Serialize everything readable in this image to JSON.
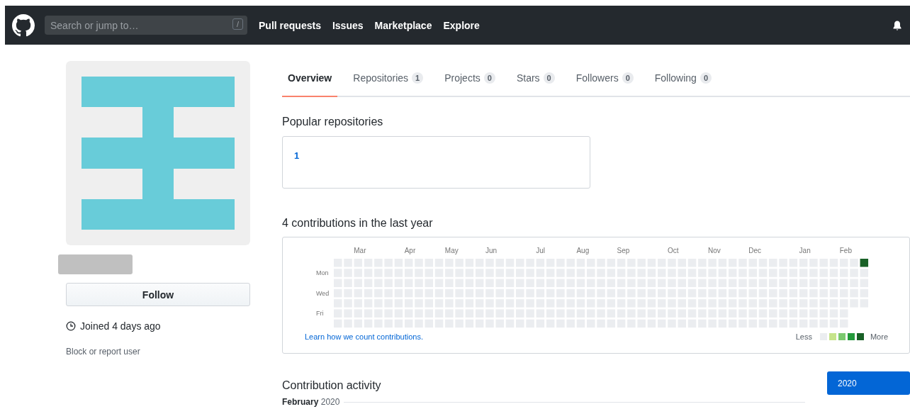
{
  "header": {
    "search": {
      "placeholder": "Search or jump to…",
      "shortcut": "/"
    },
    "nav": [
      "Pull requests",
      "Issues",
      "Marketplace",
      "Explore"
    ]
  },
  "profile": {
    "follow_button": "Follow",
    "joined": "Joined 4 days ago",
    "block_link": "Block or report user"
  },
  "tabs": [
    {
      "label": "Overview",
      "selected": true
    },
    {
      "label": "Repositories",
      "count": "1",
      "selected": false
    },
    {
      "label": "Projects",
      "count": "0",
      "selected": false
    },
    {
      "label": "Stars",
      "count": "0",
      "selected": false
    },
    {
      "label": "Followers",
      "count": "0",
      "selected": false
    },
    {
      "label": "Following",
      "count": "0",
      "selected": false
    }
  ],
  "popular": {
    "title": "Popular repositories",
    "repos": [
      {
        "name": "1"
      }
    ]
  },
  "contributions": {
    "title": "4 contributions in the last year",
    "months": [
      "Mar",
      "Apr",
      "May",
      "Jun",
      "Jul",
      "Aug",
      "Sep",
      "Oct",
      "Nov",
      "Dec",
      "Jan",
      "Feb"
    ],
    "days": [
      "Mon",
      "Wed",
      "Fri"
    ],
    "weeks": [
      [
        {
          "color": "#ebedf0"
        },
        {
          "color": "#ebedf0"
        },
        {
          "color": "#ebedf0"
        },
        {
          "color": "#ebedf0"
        },
        {
          "color": "#ebedf0"
        },
        {
          "color": "#ebedf0"
        },
        {
          "color": "#ebedf0"
        }
      ],
      [
        {
          "color": "#ebedf0"
        },
        {
          "color": "#ebedf0"
        },
        {
          "color": "#ebedf0"
        },
        {
          "color": "#ebedf0"
        },
        {
          "color": "#ebedf0"
        },
        {
          "color": "#ebedf0"
        },
        {
          "color": "#ebedf0"
        }
      ],
      [
        {
          "color": "#ebedf0"
        },
        {
          "color": "#ebedf0"
        },
        {
          "color": "#ebedf0"
        },
        {
          "color": "#ebedf0"
        },
        {
          "color": "#ebedf0"
        },
        {
          "color": "#ebedf0"
        },
        {
          "color": "#ebedf0"
        }
      ],
      [
        {
          "color": "#ebedf0"
        },
        {
          "color": "#ebedf0"
        },
        {
          "color": "#ebedf0"
        },
        {
          "color": "#ebedf0"
        },
        {
          "color": "#ebedf0"
        },
        {
          "color": "#ebedf0"
        },
        {
          "color": "#ebedf0"
        }
      ],
      [
        {
          "color": "#ebedf0"
        },
        {
          "color": "#ebedf0"
        },
        {
          "color": "#ebedf0"
        },
        {
          "color": "#ebedf0"
        },
        {
          "color": "#ebedf0"
        },
        {
          "color": "#ebedf0"
        },
        {
          "color": "#ebedf0"
        }
      ],
      [
        {
          "color": "#ebedf0"
        },
        {
          "color": "#ebedf0"
        },
        {
          "color": "#ebedf0"
        },
        {
          "color": "#ebedf0"
        },
        {
          "color": "#ebedf0"
        },
        {
          "color": "#ebedf0"
        },
        {
          "color": "#ebedf0"
        }
      ],
      [
        {
          "color": "#ebedf0"
        },
        {
          "color": "#ebedf0"
        },
        {
          "color": "#ebedf0"
        },
        {
          "color": "#ebedf0"
        },
        {
          "color": "#ebedf0"
        },
        {
          "color": "#ebedf0"
        },
        {
          "color": "#ebedf0"
        }
      ],
      [
        {
          "color": "#ebedf0"
        },
        {
          "color": "#ebedf0"
        },
        {
          "color": "#ebedf0"
        },
        {
          "color": "#ebedf0"
        },
        {
          "color": "#ebedf0"
        },
        {
          "color": "#ebedf0"
        },
        {
          "color": "#ebedf0"
        }
      ],
      [
        {
          "color": "#ebedf0"
        },
        {
          "color": "#ebedf0"
        },
        {
          "color": "#ebedf0"
        },
        {
          "color": "#ebedf0"
        },
        {
          "color": "#ebedf0"
        },
        {
          "color": "#ebedf0"
        },
        {
          "color": "#ebedf0"
        }
      ],
      [
        {
          "color": "#ebedf0"
        },
        {
          "color": "#ebedf0"
        },
        {
          "color": "#ebedf0"
        },
        {
          "color": "#ebedf0"
        },
        {
          "color": "#ebedf0"
        },
        {
          "color": "#ebedf0"
        },
        {
          "color": "#ebedf0"
        }
      ],
      [
        {
          "color": "#ebedf0"
        },
        {
          "color": "#ebedf0"
        },
        {
          "color": "#ebedf0"
        },
        {
          "color": "#ebedf0"
        },
        {
          "color": "#ebedf0"
        },
        {
          "color": "#ebedf0"
        },
        {
          "color": "#ebedf0"
        }
      ],
      [
        {
          "color": "#ebedf0"
        },
        {
          "color": "#ebedf0"
        },
        {
          "color": "#ebedf0"
        },
        {
          "color": "#ebedf0"
        },
        {
          "color": "#ebedf0"
        },
        {
          "color": "#ebedf0"
        },
        {
          "color": "#ebedf0"
        }
      ],
      [
        {
          "color": "#ebedf0"
        },
        {
          "color": "#ebedf0"
        },
        {
          "color": "#ebedf0"
        },
        {
          "color": "#ebedf0"
        },
        {
          "color": "#ebedf0"
        },
        {
          "color": "#ebedf0"
        },
        {
          "color": "#ebedf0"
        }
      ],
      [
        {
          "color": "#ebedf0"
        },
        {
          "color": "#ebedf0"
        },
        {
          "color": "#ebedf0"
        },
        {
          "color": "#ebedf0"
        },
        {
          "color": "#ebedf0"
        },
        {
          "color": "#ebedf0"
        },
        {
          "color": "#ebedf0"
        }
      ],
      [
        {
          "color": "#ebedf0"
        },
        {
          "color": "#ebedf0"
        },
        {
          "color": "#ebedf0"
        },
        {
          "color": "#ebedf0"
        },
        {
          "color": "#ebedf0"
        },
        {
          "color": "#ebedf0"
        },
        {
          "color": "#ebedf0"
        }
      ],
      [
        {
          "color": "#ebedf0"
        },
        {
          "color": "#ebedf0"
        },
        {
          "color": "#ebedf0"
        },
        {
          "color": "#ebedf0"
        },
        {
          "color": "#ebedf0"
        },
        {
          "color": "#ebedf0"
        },
        {
          "color": "#ebedf0"
        }
      ],
      [
        {
          "color": "#ebedf0"
        },
        {
          "color": "#ebedf0"
        },
        {
          "color": "#ebedf0"
        },
        {
          "color": "#ebedf0"
        },
        {
          "color": "#ebedf0"
        },
        {
          "color": "#ebedf0"
        },
        {
          "color": "#ebedf0"
        }
      ],
      [
        {
          "color": "#ebedf0"
        },
        {
          "color": "#ebedf0"
        },
        {
          "color": "#ebedf0"
        },
        {
          "color": "#ebedf0"
        },
        {
          "color": "#ebedf0"
        },
        {
          "color": "#ebedf0"
        },
        {
          "color": "#ebedf0"
        }
      ],
      [
        {
          "color": "#ebedf0"
        },
        {
          "color": "#ebedf0"
        },
        {
          "color": "#ebedf0"
        },
        {
          "color": "#ebedf0"
        },
        {
          "color": "#ebedf0"
        },
        {
          "color": "#ebedf0"
        },
        {
          "color": "#ebedf0"
        }
      ],
      [
        {
          "color": "#ebedf0"
        },
        {
          "color": "#ebedf0"
        },
        {
          "color": "#ebedf0"
        },
        {
          "color": "#ebedf0"
        },
        {
          "color": "#ebedf0"
        },
        {
          "color": "#ebedf0"
        },
        {
          "color": "#ebedf0"
        }
      ],
      [
        {
          "color": "#ebedf0"
        },
        {
          "color": "#ebedf0"
        },
        {
          "color": "#ebedf0"
        },
        {
          "color": "#ebedf0"
        },
        {
          "color": "#ebedf0"
        },
        {
          "color": "#ebedf0"
        },
        {
          "color": "#ebedf0"
        }
      ],
      [
        {
          "color": "#ebedf0"
        },
        {
          "color": "#ebedf0"
        },
        {
          "color": "#ebedf0"
        },
        {
          "color": "#ebedf0"
        },
        {
          "color": "#ebedf0"
        },
        {
          "color": "#ebedf0"
        },
        {
          "color": "#ebedf0"
        }
      ],
      [
        {
          "color": "#ebedf0"
        },
        {
          "color": "#ebedf0"
        },
        {
          "color": "#ebedf0"
        },
        {
          "color": "#ebedf0"
        },
        {
          "color": "#ebedf0"
        },
        {
          "color": "#ebedf0"
        },
        {
          "color": "#ebedf0"
        }
      ],
      [
        {
          "color": "#ebedf0"
        },
        {
          "color": "#ebedf0"
        },
        {
          "color": "#ebedf0"
        },
        {
          "color": "#ebedf0"
        },
        {
          "color": "#ebedf0"
        },
        {
          "color": "#ebedf0"
        },
        {
          "color": "#ebedf0"
        }
      ],
      [
        {
          "color": "#ebedf0"
        },
        {
          "color": "#ebedf0"
        },
        {
          "color": "#ebedf0"
        },
        {
          "color": "#ebedf0"
        },
        {
          "color": "#ebedf0"
        },
        {
          "color": "#ebedf0"
        },
        {
          "color": "#ebedf0"
        }
      ],
      [
        {
          "color": "#ebedf0"
        },
        {
          "color": "#ebedf0"
        },
        {
          "color": "#ebedf0"
        },
        {
          "color": "#ebedf0"
        },
        {
          "color": "#ebedf0"
        },
        {
          "color": "#ebedf0"
        },
        {
          "color": "#ebedf0"
        }
      ],
      [
        {
          "color": "#ebedf0"
        },
        {
          "color": "#ebedf0"
        },
        {
          "color": "#ebedf0"
        },
        {
          "color": "#ebedf0"
        },
        {
          "color": "#ebedf0"
        },
        {
          "color": "#ebedf0"
        },
        {
          "color": "#ebedf0"
        }
      ],
      [
        {
          "color": "#ebedf0"
        },
        {
          "color": "#ebedf0"
        },
        {
          "color": "#ebedf0"
        },
        {
          "color": "#ebedf0"
        },
        {
          "color": "#ebedf0"
        },
        {
          "color": "#ebedf0"
        },
        {
          "color": "#ebedf0"
        }
      ],
      [
        {
          "color": "#ebedf0"
        },
        {
          "color": "#ebedf0"
        },
        {
          "color": "#ebedf0"
        },
        {
          "color": "#ebedf0"
        },
        {
          "color": "#ebedf0"
        },
        {
          "color": "#ebedf0"
        },
        {
          "color": "#ebedf0"
        }
      ],
      [
        {
          "color": "#ebedf0"
        },
        {
          "color": "#ebedf0"
        },
        {
          "color": "#ebedf0"
        },
        {
          "color": "#ebedf0"
        },
        {
          "color": "#ebedf0"
        },
        {
          "color": "#ebedf0"
        },
        {
          "color": "#ebedf0"
        }
      ],
      [
        {
          "color": "#ebedf0"
        },
        {
          "color": "#ebedf0"
        },
        {
          "color": "#ebedf0"
        },
        {
          "color": "#ebedf0"
        },
        {
          "color": "#ebedf0"
        },
        {
          "color": "#ebedf0"
        },
        {
          "color": "#ebedf0"
        }
      ],
      [
        {
          "color": "#ebedf0"
        },
        {
          "color": "#ebedf0"
        },
        {
          "color": "#ebedf0"
        },
        {
          "color": "#ebedf0"
        },
        {
          "color": "#ebedf0"
        },
        {
          "color": "#ebedf0"
        },
        {
          "color": "#ebedf0"
        }
      ],
      [
        {
          "color": "#ebedf0"
        },
        {
          "color": "#ebedf0"
        },
        {
          "color": "#ebedf0"
        },
        {
          "color": "#ebedf0"
        },
        {
          "color": "#ebedf0"
        },
        {
          "color": "#ebedf0"
        },
        {
          "color": "#ebedf0"
        }
      ],
      [
        {
          "color": "#ebedf0"
        },
        {
          "color": "#ebedf0"
        },
        {
          "color": "#ebedf0"
        },
        {
          "color": "#ebedf0"
        },
        {
          "color": "#ebedf0"
        },
        {
          "color": "#ebedf0"
        },
        {
          "color": "#ebedf0"
        }
      ],
      [
        {
          "color": "#ebedf0"
        },
        {
          "color": "#ebedf0"
        },
        {
          "color": "#ebedf0"
        },
        {
          "color": "#ebedf0"
        },
        {
          "color": "#ebedf0"
        },
        {
          "color": "#ebedf0"
        },
        {
          "color": "#ebedf0"
        }
      ],
      [
        {
          "color": "#ebedf0"
        },
        {
          "color": "#ebedf0"
        },
        {
          "color": "#ebedf0"
        },
        {
          "color": "#ebedf0"
        },
        {
          "color": "#ebedf0"
        },
        {
          "color": "#ebedf0"
        },
        {
          "color": "#ebedf0"
        }
      ],
      [
        {
          "color": "#ebedf0"
        },
        {
          "color": "#ebedf0"
        },
        {
          "color": "#ebedf0"
        },
        {
          "color": "#ebedf0"
        },
        {
          "color": "#ebedf0"
        },
        {
          "color": "#ebedf0"
        },
        {
          "color": "#ebedf0"
        }
      ],
      [
        {
          "color": "#ebedf0"
        },
        {
          "color": "#ebedf0"
        },
        {
          "color": "#ebedf0"
        },
        {
          "color": "#ebedf0"
        },
        {
          "color": "#ebedf0"
        },
        {
          "color": "#ebedf0"
        },
        {
          "color": "#ebedf0"
        }
      ],
      [
        {
          "color": "#ebedf0"
        },
        {
          "color": "#ebedf0"
        },
        {
          "color": "#ebedf0"
        },
        {
          "color": "#ebedf0"
        },
        {
          "color": "#ebedf0"
        },
        {
          "color": "#ebedf0"
        },
        {
          "color": "#ebedf0"
        }
      ],
      [
        {
          "color": "#ebedf0"
        },
        {
          "color": "#ebedf0"
        },
        {
          "color": "#ebedf0"
        },
        {
          "color": "#ebedf0"
        },
        {
          "color": "#ebedf0"
        },
        {
          "color": "#ebedf0"
        },
        {
          "color": "#ebedf0"
        }
      ],
      [
        {
          "color": "#ebedf0"
        },
        {
          "color": "#ebedf0"
        },
        {
          "color": "#ebedf0"
        },
        {
          "color": "#ebedf0"
        },
        {
          "color": "#ebedf0"
        },
        {
          "color": "#ebedf0"
        },
        {
          "color": "#ebedf0"
        }
      ],
      [
        {
          "color": "#ebedf0"
        },
        {
          "color": "#ebedf0"
        },
        {
          "color": "#ebedf0"
        },
        {
          "color": "#ebedf0"
        },
        {
          "color": "#ebedf0"
        },
        {
          "color": "#ebedf0"
        },
        {
          "color": "#ebedf0"
        }
      ],
      [
        {
          "color": "#ebedf0"
        },
        {
          "color": "#ebedf0"
        },
        {
          "color": "#ebedf0"
        },
        {
          "color": "#ebedf0"
        },
        {
          "color": "#ebedf0"
        },
        {
          "color": "#ebedf0"
        },
        {
          "color": "#ebedf0"
        }
      ],
      [
        {
          "color": "#ebedf0"
        },
        {
          "color": "#ebedf0"
        },
        {
          "color": "#ebedf0"
        },
        {
          "color": "#ebedf0"
        },
        {
          "color": "#ebedf0"
        },
        {
          "color": "#ebedf0"
        },
        {
          "color": "#ebedf0"
        }
      ],
      [
        {
          "color": "#ebedf0"
        },
        {
          "color": "#ebedf0"
        },
        {
          "color": "#ebedf0"
        },
        {
          "color": "#ebedf0"
        },
        {
          "color": "#ebedf0"
        },
        {
          "color": "#ebedf0"
        },
        {
          "color": "#ebedf0"
        }
      ],
      [
        {
          "color": "#ebedf0"
        },
        {
          "color": "#ebedf0"
        },
        {
          "color": "#ebedf0"
        },
        {
          "color": "#ebedf0"
        },
        {
          "color": "#ebedf0"
        },
        {
          "color": "#ebedf0"
        },
        {
          "color": "#ebedf0"
        }
      ],
      [
        {
          "color": "#ebedf0"
        },
        {
          "color": "#ebedf0"
        },
        {
          "color": "#ebedf0"
        },
        {
          "color": "#ebedf0"
        },
        {
          "color": "#ebedf0"
        },
        {
          "color": "#ebedf0"
        },
        {
          "color": "#ebedf0"
        }
      ],
      [
        {
          "color": "#ebedf0"
        },
        {
          "color": "#ebedf0"
        },
        {
          "color": "#ebedf0"
        },
        {
          "color": "#ebedf0"
        },
        {
          "color": "#ebedf0"
        },
        {
          "color": "#ebedf0"
        },
        {
          "color": "#ebedf0"
        }
      ],
      [
        {
          "color": "#ebedf0"
        },
        {
          "color": "#ebedf0"
        },
        {
          "color": "#ebedf0"
        },
        {
          "color": "#ebedf0"
        },
        {
          "color": "#ebedf0"
        },
        {
          "color": "#ebedf0"
        },
        {
          "color": "#ebedf0"
        }
      ],
      [
        {
          "color": "#ebedf0"
        },
        {
          "color": "#ebedf0"
        },
        {
          "color": "#ebedf0"
        },
        {
          "color": "#ebedf0"
        },
        {
          "color": "#ebedf0"
        },
        {
          "color": "#ebedf0"
        },
        {
          "color": "#ebedf0"
        }
      ],
      [
        {
          "color": "#ebedf0"
        },
        {
          "color": "#ebedf0"
        },
        {
          "color": "#ebedf0"
        },
        {
          "color": "#ebedf0"
        },
        {
          "color": "#ebedf0"
        },
        {
          "color": "#ebedf0"
        },
        {
          "color": "#ebedf0"
        }
      ],
      [
        {
          "color": "#ebedf0"
        },
        {
          "color": "#ebedf0"
        },
        {
          "color": "#ebedf0"
        },
        {
          "color": "#ebedf0"
        },
        {
          "color": "#ebedf0"
        }
      ],
      [
        {
          "color": "#196127"
        },
        {
          "color": "#ebedf0"
        },
        {
          "color": "#ebedf0"
        },
        {
          "color": "#ebedf0"
        },
        {
          "color": "#ebedf0"
        }
      ]
    ],
    "legend": [
      {
        "color": "#ebedf0"
      },
      {
        "color": "#c6e48b"
      },
      {
        "color": "#7bc96f"
      },
      {
        "color": "#239a3b"
      },
      {
        "color": "#196127"
      }
    ],
    "learn_link": "Learn how we count contributions.",
    "less": "Less",
    "more": "More"
  },
  "activity": {
    "title": "Contribution activity",
    "years": [
      {
        "label": "2020",
        "selected": true
      }
    ],
    "month": "February",
    "year": "2020"
  }
}
